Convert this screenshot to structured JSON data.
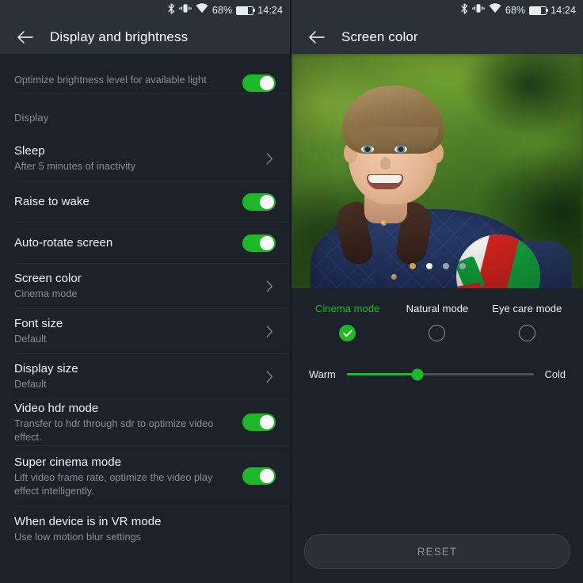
{
  "status_bar": {
    "bluetooth_icon": "bluetooth-icon",
    "vibrate_icon": "vibrate-icon",
    "wifi_icon": "wifi-icon",
    "battery_percent": "68%",
    "battery_icon": "battery-icon",
    "time": "14:24"
  },
  "colors": {
    "accent_green": "#1db828",
    "background": "#1d222a",
    "appbar": "#2b3138",
    "primary_text": "#f1f3f5",
    "secondary_text": "#868e96",
    "divider": "#272d35"
  },
  "left_panel": {
    "back_icon": "back-arrow-icon",
    "title": "Display and brightness",
    "clipped_row": {
      "subtitle": "Optimize brightness level for available light",
      "toggle": "on"
    },
    "section_label": "Display",
    "items": [
      {
        "title": "Sleep",
        "subtitle": "After 5 minutes of inactivity",
        "control": "chevron",
        "chevron_icon": "chevron-right-icon"
      },
      {
        "title": "Raise to wake",
        "subtitle": "",
        "control": "toggle",
        "toggle": "on"
      },
      {
        "title": "Auto-rotate screen",
        "subtitle": "",
        "control": "toggle",
        "toggle": "on"
      },
      {
        "title": "Screen color",
        "subtitle": "Cinema mode",
        "control": "chevron",
        "chevron_icon": "chevron-right-icon"
      },
      {
        "title": "Font size",
        "subtitle": "Default",
        "control": "chevron",
        "chevron_icon": "chevron-right-icon"
      },
      {
        "title": "Display size",
        "subtitle": "Default",
        "control": "chevron",
        "chevron_icon": "chevron-right-icon"
      },
      {
        "title": "Video hdr mode",
        "subtitle": "Transfer to hdr through sdr to optimize video effect.",
        "control": "toggle",
        "toggle": "on"
      },
      {
        "title": "Super cinema mode",
        "subtitle": "Lift video frame rate, optimize the video play effect intelligently.",
        "control": "toggle",
        "toggle": "on"
      },
      {
        "title": "When device is in VR mode",
        "subtitle": "Use low motion blur settings",
        "control": "none"
      }
    ]
  },
  "right_panel": {
    "back_icon": "back-arrow-icon",
    "title": "Screen color",
    "preview": {
      "description": "Photo of a smiling boy in a navy quilted jacket holding a red and green volleyball in front of blurred green foliage",
      "pager_dots": [
        {
          "color": "#c8a24a",
          "active": false
        },
        {
          "color": "#ffffff",
          "active": true
        },
        {
          "color": "#9aa3ac",
          "active": false
        },
        {
          "color": "#9aa3ac",
          "active": false
        }
      ]
    },
    "modes": [
      {
        "label": "Cinema mode",
        "selected": true,
        "check_icon": "check-icon"
      },
      {
        "label": "Natural mode",
        "selected": false
      },
      {
        "label": "Eye care mode",
        "selected": false
      }
    ],
    "temperature_slider": {
      "left_label": "Warm",
      "right_label": "Cold",
      "value_percent": 38
    },
    "reset_button": "RESET"
  }
}
